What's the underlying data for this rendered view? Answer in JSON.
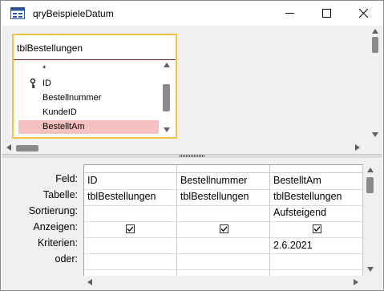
{
  "window": {
    "title": "qryBeispieleDatum",
    "icons": [
      "query-icon",
      "minimize-icon",
      "maximize-icon",
      "close-icon"
    ]
  },
  "table": {
    "name": "tblBestellungen",
    "fields": [
      "*",
      "ID",
      "Bestellnummer",
      "KundeID",
      "BestelltAm"
    ],
    "selected_field": "BestelltAm",
    "highlight_color": "#f5c342"
  },
  "grid": {
    "row_labels": [
      "Feld:",
      "Tabelle:",
      "Sortierung:",
      "Anzeigen:",
      "Kriterien:",
      "oder:"
    ],
    "columns": [
      {
        "feld": "ID",
        "tabelle": "tblBestellungen",
        "sortierung": "",
        "anzeigen": true,
        "kriterien": ""
      },
      {
        "feld": "Bestellnummer",
        "tabelle": "tblBestellungen",
        "sortierung": "",
        "anzeigen": true,
        "kriterien": ""
      },
      {
        "feld": "BestelltAm",
        "tabelle": "tblBestellungen",
        "sortierung": "Aufsteigend",
        "anzeigen": true,
        "kriterien": "2.6.2021"
      }
    ]
  }
}
